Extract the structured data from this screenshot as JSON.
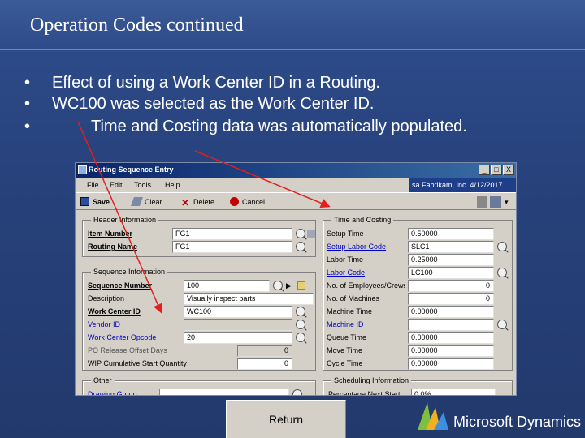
{
  "slide": {
    "title": "Operation Codes continued",
    "bullets": [
      {
        "marker": "•",
        "text": "Effect of using a Work Center ID in a Routing."
      },
      {
        "marker": "•",
        "text": "WC100 was selected as the Work Center ID."
      },
      {
        "marker": "•",
        "text": "Time and Costing data was automatically populated."
      }
    ]
  },
  "window": {
    "title": "Routing Sequence Entry",
    "controls": {
      "minimize": "_",
      "maximize": "□",
      "close": "X"
    },
    "menu": [
      "File",
      "Edit",
      "Tools",
      "Help"
    ],
    "company": "sa Fabrikam, Inc. 4/12/2017",
    "toolbar": {
      "save": "Save",
      "clear": "Clear",
      "delete": "Delete",
      "cancel": "Cancel"
    },
    "header_info": {
      "title": "Header Information",
      "item_number_label": "Item Number",
      "item_number_value": "FG1",
      "routing_name_label": "Routing Name",
      "routing_name_value": "FG1"
    },
    "sequence_info": {
      "title": "Sequence Information",
      "sequence_number_label": "Sequence Number",
      "sequence_number_value": "100",
      "description_label": "Description",
      "description_value": "Visually inspect parts",
      "work_center_id_label": "Work Center ID",
      "work_center_id_value": "WC100",
      "vendor_id_label": "Vendor ID",
      "work_center_opcode_label": "Work Center Opcode",
      "work_center_opcode_value": "20",
      "po_release_label": "PO Release Offset Days",
      "po_release_value": "0",
      "wip_label": "WIP Cumulative Start Quantity",
      "wip_value": "0"
    },
    "time_costing": {
      "title": "Time and Costing",
      "rows": [
        {
          "label": "Setup Time",
          "value": "0.50000",
          "style": "normal",
          "lookup": false
        },
        {
          "label": "Setup Labor Code",
          "value": "SLC1",
          "style": "link",
          "lookup": true
        },
        {
          "label": "Labor Time",
          "value": "0.25000",
          "style": "normal",
          "lookup": false
        },
        {
          "label": "Labor Code",
          "value": "LC100",
          "style": "link",
          "lookup": true
        },
        {
          "label": "No. of Employees/Crews",
          "value": "0",
          "style": "normal",
          "lookup": false
        },
        {
          "label": "No. of Machines",
          "value": "0",
          "style": "normal",
          "lookup": false
        },
        {
          "label": "Machine Time",
          "value": "0.00000",
          "style": "normal",
          "lookup": false
        },
        {
          "label": "Machine ID",
          "value": "",
          "style": "link",
          "lookup": true
        },
        {
          "label": "Queue Time",
          "value": "0.00000",
          "style": "normal",
          "lookup": false
        },
        {
          "label": "Move Time",
          "value": "0.00000",
          "style": "normal",
          "lookup": false
        },
        {
          "label": "Cycle Time",
          "value": "0.00000",
          "style": "normal",
          "lookup": false
        }
      ]
    },
    "other": {
      "title": "Other",
      "drawing_group_label": "Drawing Group"
    },
    "scheduling": {
      "title": "Scheduling Information",
      "percentage_label": "Percentage Next Start",
      "percentage_value": "0.0%"
    }
  },
  "return_button": "Return",
  "logo": {
    "text": "Microsoft Dynamics"
  },
  "colors": {
    "background": "#27427c",
    "arrow": "#e02020",
    "title_bar": "#0a246a"
  }
}
